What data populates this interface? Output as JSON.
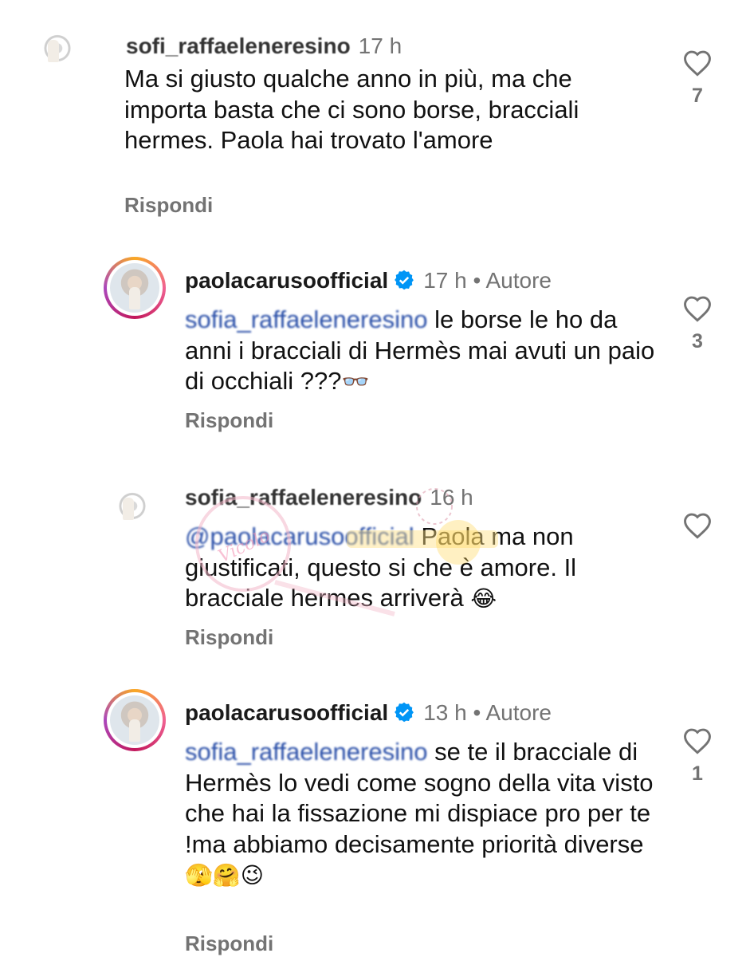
{
  "comments": [
    {
      "username": "sofi_raffaeleneresino",
      "time": "17 h",
      "author_label": "",
      "mention": "",
      "text": "Ma si giusto qualche anno in più, ma che importa basta che ci sono borse, bracciali hermes. Paola hai trovato l'amore",
      "emojis": "",
      "reply_label": "Rispondi",
      "likes": "7"
    },
    {
      "username": "paolacarusoofficial",
      "time": "17 h",
      "author_label": "• Autore",
      "mention": "sofia_raffaeleneresino",
      "text": "le borse le ho da anni i bracciali di Hermès mai avuti un paio di occhiali ???",
      "emojis": "👓",
      "reply_label": "Rispondi",
      "likes": "3"
    },
    {
      "username": "sofia_raffaeleneresino",
      "time": "16 h",
      "author_label": "",
      "mention": "@paolacarusoofficial",
      "text": "Paola ma non giustificati, questo si che è amore. Il bracciale hermes arriverà",
      "emojis": "😂",
      "reply_label": "Rispondi",
      "likes": ""
    },
    {
      "username": "paolacarusoofficial",
      "time": "13 h",
      "author_label": "• Autore",
      "mention": "sofia_raffaeleneresino",
      "text": "se te il bracciale di Hermès lo vedi come sogno della vita visto che hai la fissazione mi dispiace pro per te !ma abbiamo decisamente priorità diverse",
      "emojis": "🫣🤗😉",
      "reply_label": "Rispondi",
      "likes": "1"
    }
  ],
  "watermark_text": "Vicolo delle News",
  "colors": {
    "verified": "#0095f6",
    "secondary": "#737373",
    "mention": "#2a4fa8"
  }
}
